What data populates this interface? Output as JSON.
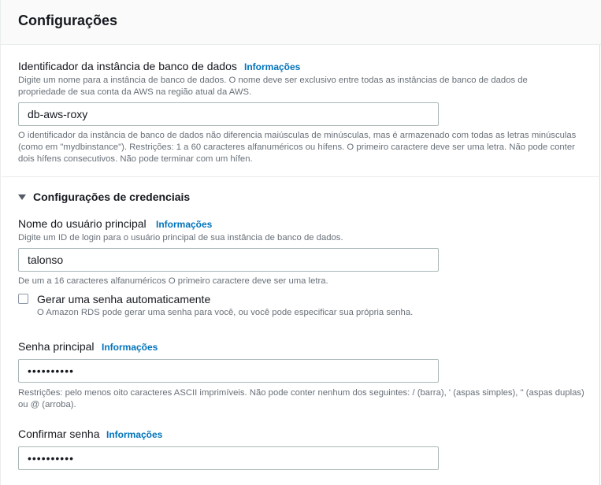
{
  "header": {
    "title": "Configurações"
  },
  "db_identifier": {
    "label": "Identificador da instância de banco de dados",
    "info": "Informações",
    "description": "Digite um nome para a instância de banco de dados. O nome deve ser exclusivo entre todas as instâncias de banco de dados de propriedade de sua conta da AWS na região atual da AWS.",
    "value": "db-aws-roxy",
    "constraints": "O identificador da instância de banco de dados não diferencia maiúsculas de minúsculas, mas é armazenado com todas as letras minúsculas (como em \"mydbinstance\"). Restrições: 1 a 60 caracteres alfanuméricos ou hífens. O primeiro caractere deve ser uma letra. Não pode conter dois hífens consecutivos. Não pode terminar com um hífen."
  },
  "credentials": {
    "section_title": "Configurações de credenciais",
    "username": {
      "label": "Nome do usuário principal",
      "info": "Informações",
      "description": "Digite um ID de login para o usuário principal de sua instância de banco de dados.",
      "value": "talonso",
      "constraints": "De um a 16 caracteres alfanuméricos O primeiro caractere deve ser uma letra."
    },
    "auto_password": {
      "label": "Gerar uma senha automaticamente",
      "description": "O Amazon RDS pode gerar uma senha para você, ou você pode especificar sua própria senha.",
      "checked": false
    },
    "password": {
      "label": "Senha principal",
      "info": "Informações",
      "value": "••••••••••",
      "constraints": "Restrições: pelo menos oito caracteres ASCII imprimíveis. Não pode conter nenhum dos seguintes: / (barra), ' (aspas simples), \" (aspas duplas) ou @ (arroba)."
    },
    "confirm_password": {
      "label": "Confirmar senha",
      "info": "Informações",
      "value": "••••••••••"
    }
  },
  "colors": {
    "link": "#0073bb",
    "muted": "#687078",
    "text": "#16191f",
    "border": "#aab7b8"
  }
}
